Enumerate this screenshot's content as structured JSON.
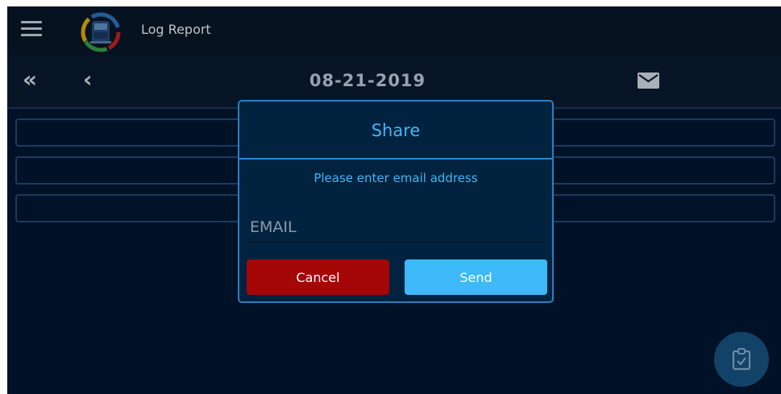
{
  "app": {
    "title": "Log Report"
  },
  "navigation": {
    "date": "08-21-2019"
  },
  "icons": {
    "menu": "hamburger-menu-icon",
    "logo": "truck-logo-icon",
    "first": "double-chevron-left-icon",
    "prev": "chevron-left-icon",
    "mail": "envelope-icon",
    "fab": "clipboard-check-icon"
  },
  "dialog": {
    "title": "Share",
    "message": "Please enter email address",
    "email_value": "",
    "email_placeholder": "EMAIL",
    "cancel_label": "Cancel",
    "send_label": "Send"
  },
  "colors": {
    "background": "#00162e",
    "accent": "#3db8f8",
    "cancel": "#a50606",
    "dialog_border": "#2a7fc0"
  }
}
